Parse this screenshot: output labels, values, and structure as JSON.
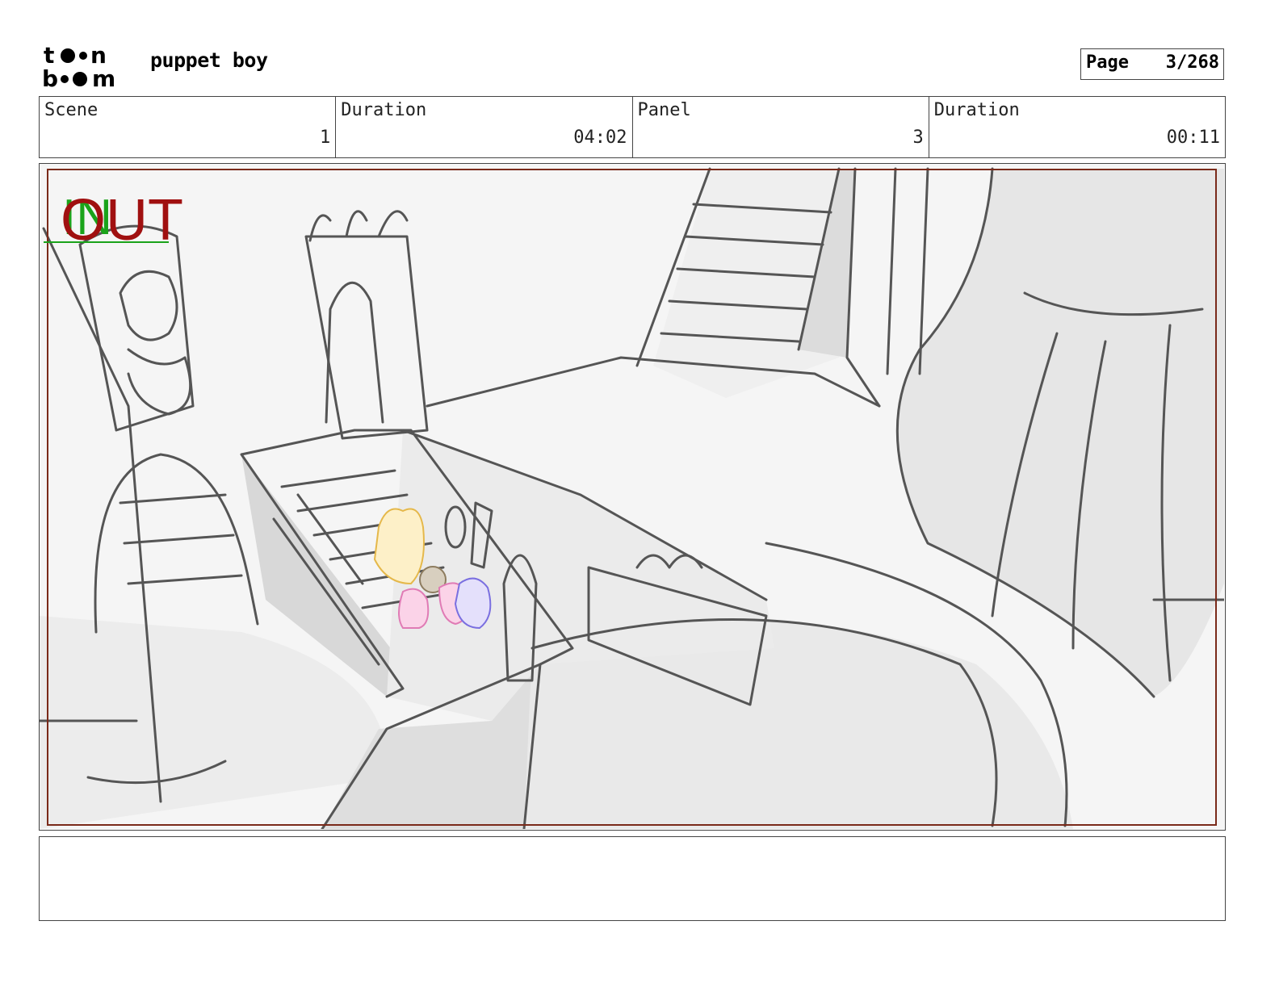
{
  "header": {
    "logo_text": "toon boom",
    "project_title": "puppet boy",
    "page_label": "Page",
    "page_value": "3/268"
  },
  "info_bar": {
    "scene_label": "Scene",
    "scene_value": "1",
    "scene_duration_label": "Duration",
    "scene_duration_value": "04:02",
    "panel_label": "Panel",
    "panel_value": "3",
    "panel_duration_label": "Duration",
    "panel_duration_value": "00:11"
  },
  "panel": {
    "in_marker": "IN",
    "out_marker": "OUT",
    "in_color": "#1aa31a",
    "out_color": "#a01010",
    "frame_color": "#7a2a1a"
  },
  "caption": {
    "text": ""
  }
}
